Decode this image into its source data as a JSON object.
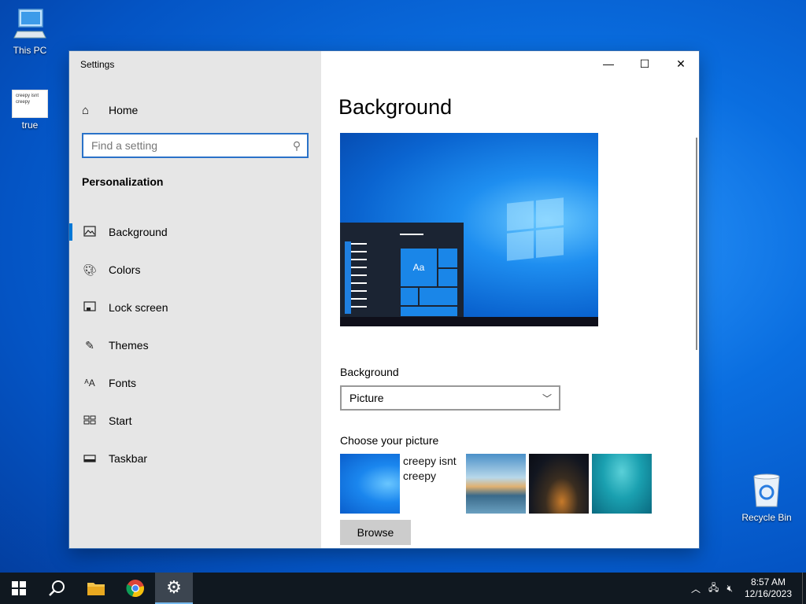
{
  "desktop": {
    "icons": [
      {
        "label": "This PC"
      },
      {
        "label": "true",
        "thumb_text": "creepy isnt creepy"
      },
      {
        "label": "Recycle Bin"
      }
    ]
  },
  "window": {
    "title": "Settings",
    "controls": {
      "minimize": "minimize-icon",
      "maximize": "maximize-icon",
      "close": "close-icon"
    }
  },
  "sidebar": {
    "home_label": "Home",
    "search_placeholder": "Find a setting",
    "section_heading": "Personalization",
    "items": [
      {
        "label": "Background",
        "icon": "picture-icon",
        "active": true
      },
      {
        "label": "Colors",
        "icon": "palette-icon"
      },
      {
        "label": "Lock screen",
        "icon": "lock-screen-icon"
      },
      {
        "label": "Themes",
        "icon": "themes-icon"
      },
      {
        "label": "Fonts",
        "icon": "fonts-icon"
      },
      {
        "label": "Start",
        "icon": "start-icon"
      },
      {
        "label": "Taskbar",
        "icon": "taskbar-icon"
      }
    ]
  },
  "main": {
    "title": "Background",
    "preview_tile_text": "Aa",
    "background_label": "Background",
    "background_value": "Picture",
    "choose_label": "Choose your picture",
    "picture_text": "creepy isnt creepy",
    "browse_label": "Browse"
  },
  "taskbar": {
    "time": "8:57 AM",
    "date": "12/16/2023",
    "accent": "#76b9ed"
  }
}
